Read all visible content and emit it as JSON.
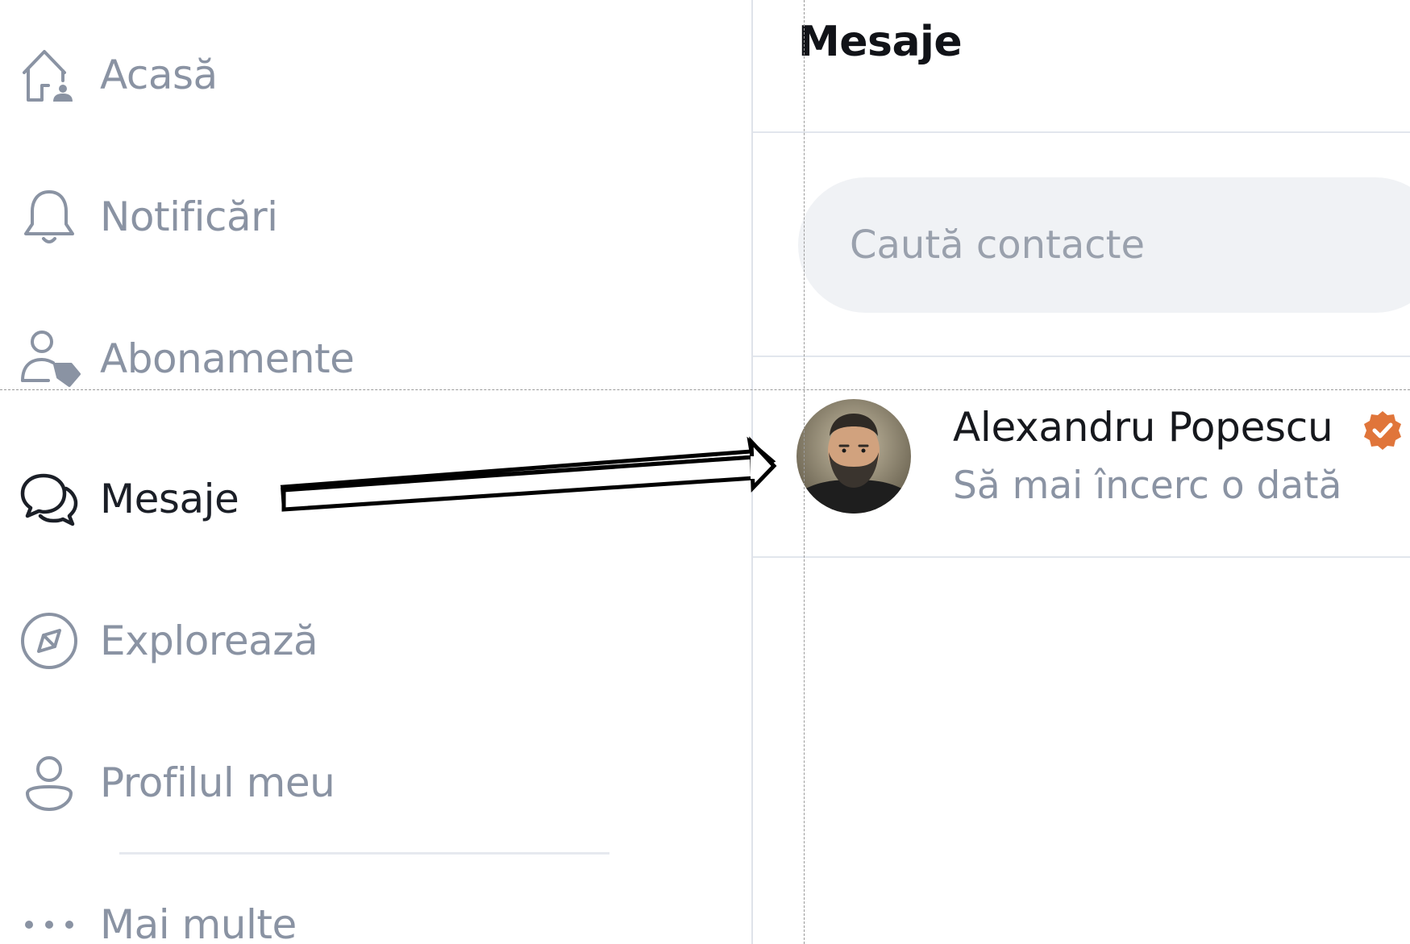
{
  "sidebar": {
    "items": [
      {
        "label": "Acasă",
        "icon": "home-user-icon"
      },
      {
        "label": "Notificări",
        "icon": "bell-icon"
      },
      {
        "label": "Abonamente",
        "icon": "user-tag-icon"
      },
      {
        "label": "Mesaje",
        "icon": "chat-bubbles-icon",
        "active": true
      },
      {
        "label": "Explorează",
        "icon": "compass-icon"
      },
      {
        "label": "Profilul meu",
        "icon": "user-icon"
      },
      {
        "label": "Mai multe",
        "icon": "more-dots-icon"
      }
    ]
  },
  "main": {
    "title": "Mesaje",
    "search": {
      "placeholder": "Caută contacte",
      "value": ""
    },
    "conversations": [
      {
        "name": "Alexandru Popescu",
        "preview": "Să mai încerc o dată",
        "verified": true,
        "avatar": "avatar-photo"
      }
    ]
  },
  "colors": {
    "active_text": "#1b1f27",
    "inactive_text": "#8a93a3",
    "verified_badge": "#e0753a",
    "divider": "#e2e6ed",
    "search_bg": "#f0f2f5"
  }
}
